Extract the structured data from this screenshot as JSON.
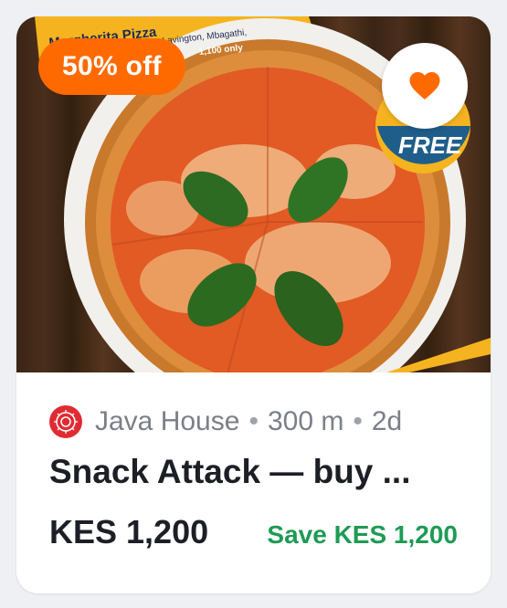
{
  "deal": {
    "discount_label": "50% off",
    "promo_banner": {
      "title": "Margherita Pizza",
      "line2": "Lavington, Mbagathi,",
      "line3": "1,100 only"
    },
    "free_stamp": "FREE",
    "merchant": "Java House",
    "distance": "300 m",
    "age": "2d",
    "title": "Snack Attack — buy ...",
    "price": "KES 1,200",
    "savings": "Save KES 1,200"
  },
  "icons": {
    "favorite": "heart-icon",
    "merchant_logo": "java-house-logo-icon"
  },
  "colors": {
    "discount_badge": "#ff6a00",
    "heart": "#ff6a00",
    "savings_text": "#1f9a55",
    "title_text": "#1c1f26",
    "meta_text": "#7b7f87",
    "banner": "#f5b41f",
    "logo": "#e02b33"
  }
}
